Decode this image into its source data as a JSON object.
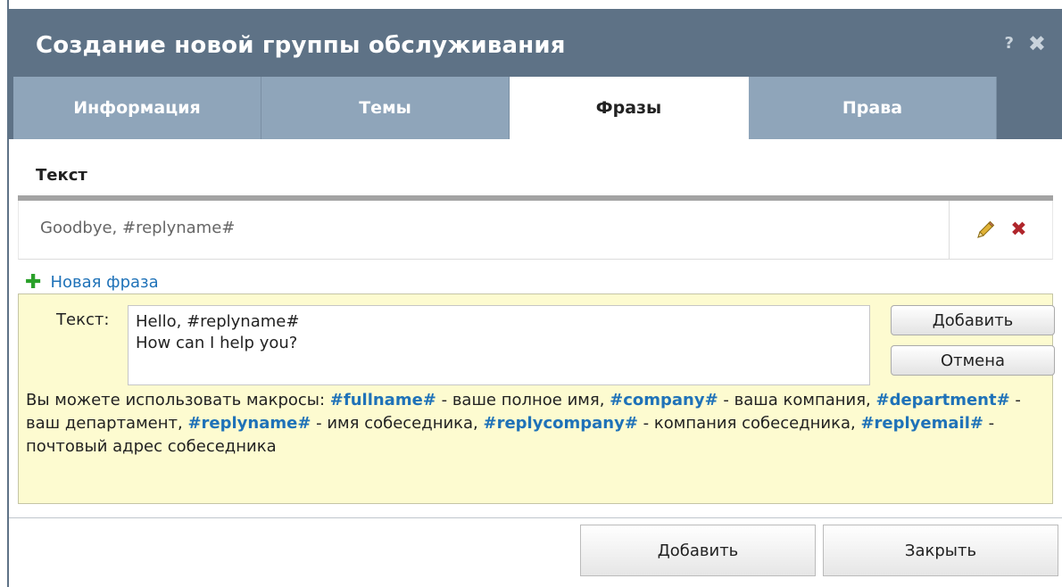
{
  "dialog": {
    "title": "Создание новой группы обслуживания",
    "help_label": "?",
    "close_label": "✖"
  },
  "tabs": [
    {
      "label": "Информация",
      "active": false
    },
    {
      "label": "Темы",
      "active": false
    },
    {
      "label": "Фразы",
      "active": true
    },
    {
      "label": "Права",
      "active": false
    }
  ],
  "phrases_table": {
    "column_header": "Текст",
    "rows": [
      {
        "text": "Goodbye, #replyname#",
        "edit_icon": "pencil-icon",
        "delete_icon": "delete-icon"
      }
    ]
  },
  "new_phrase": {
    "link_label": "Новая фраза",
    "icon": "plus-icon"
  },
  "editor": {
    "label": "Текст:",
    "value": "Hello, #replyname#\nHow can I help you?",
    "add_button": "Добавить",
    "cancel_button": "Отмена",
    "help": {
      "intro": "Вы можете использовать макросы: ",
      "macros": [
        {
          "name": "#fullname#",
          "desc": " - ваше полное имя, "
        },
        {
          "name": "#company#",
          "desc": " - ваша компания, "
        },
        {
          "name": "#department#",
          "desc": " - ваш департамент, "
        },
        {
          "name": "#replyname#",
          "desc": " - имя собеседника, "
        },
        {
          "name": "#replycompany#",
          "desc": " - компания собеседника, "
        },
        {
          "name": "#replyemail#",
          "desc": " - почтовый адрес собеседника"
        }
      ]
    }
  },
  "footer": {
    "add_button": "Добавить",
    "close_button": "Закрыть"
  },
  "colors": {
    "header_bg": "#5e7286",
    "tab_bg": "#8fa5ba",
    "editor_bg": "#fdfbd0",
    "macro_link": "#1f72b8",
    "delete_red": "#b0262c",
    "plus_green": "#2aa02a"
  }
}
